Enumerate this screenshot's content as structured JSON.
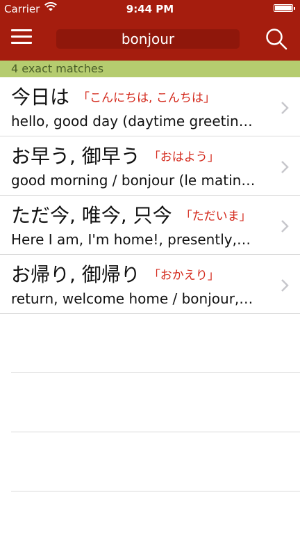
{
  "status_bar": {
    "carrier": "Carrier",
    "time": "9:44 PM",
    "icons": [
      "wifi-icon",
      "battery-icon"
    ]
  },
  "nav": {
    "search_value": "bonjour",
    "icons": [
      "hamburger-menu-icon",
      "search-icon"
    ]
  },
  "results": {
    "summary": "4 exact matches",
    "items": [
      {
        "kanji": "今日は",
        "kana": "「こんにちは, こんちは」",
        "gloss": "hello, good day (daytime greetin…"
      },
      {
        "kanji": "お早う, 御早う",
        "kana": "「おはよう」",
        "gloss": "good morning / bonjour (le matin…"
      },
      {
        "kanji": "ただ今, 唯今, 只今",
        "kana": "「ただいま」",
        "gloss": "Here I am, I'm home!, presently,…"
      },
      {
        "kanji": "お帰り, 御帰り",
        "kana": "「おかえり」",
        "gloss": "return, welcome home / bonjour,…"
      }
    ]
  },
  "colors": {
    "nav_background": "#a51d0e",
    "match_bar": "#b5cc6f",
    "kana_text": "#d42b1e"
  }
}
